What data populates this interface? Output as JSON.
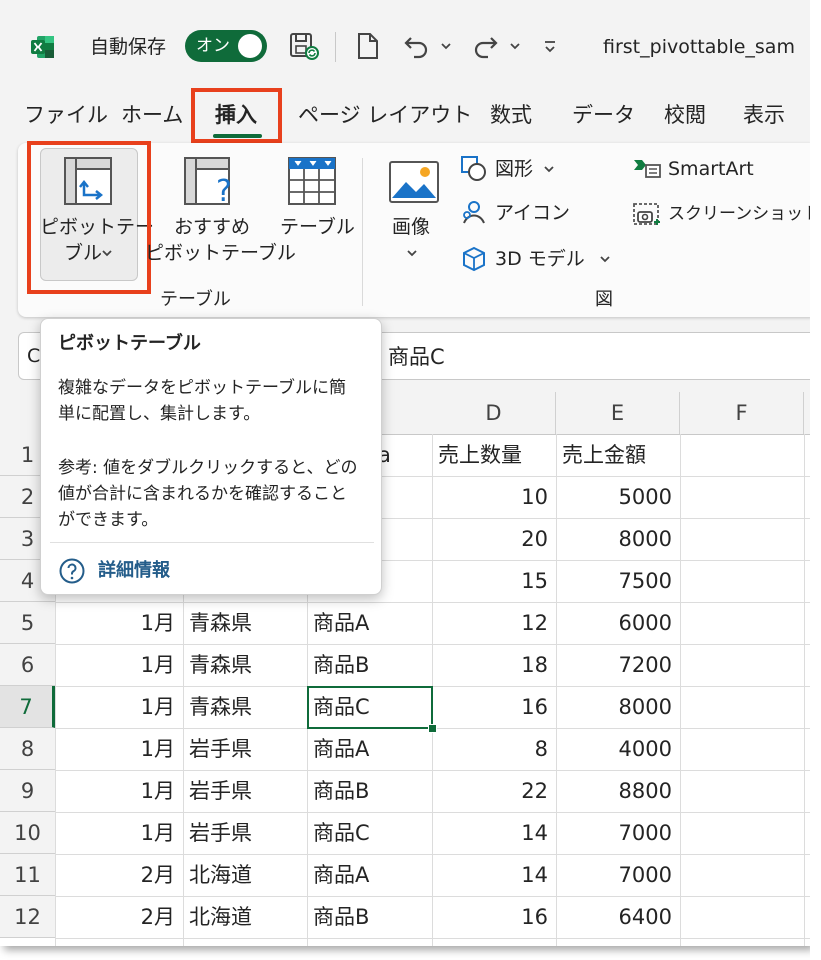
{
  "titlebar": {
    "autosave_label": "自動保存",
    "autosave_state": "オン",
    "filename": "first_pivottable_sam"
  },
  "tabs": [
    {
      "label": "ファイル",
      "active": false
    },
    {
      "label": "ホーム",
      "active": false
    },
    {
      "label": "挿入",
      "active": true
    },
    {
      "label": "ページ レイアウト",
      "active": false
    },
    {
      "label": "数式",
      "active": false
    },
    {
      "label": "データ",
      "active": false
    },
    {
      "label": "校閲",
      "active": false
    },
    {
      "label": "表示",
      "active": false
    }
  ],
  "ribbon": {
    "pivot_line1": "ピボットテー",
    "pivot_line2": "ブル",
    "recommended_line1": "おすすめ",
    "recommended_line2": "ピボットテーブル",
    "table": "テーブル",
    "group_table": "テーブル",
    "image": "画像",
    "shapes": "図形",
    "icons": "アイコン",
    "model3d": "3D モデル",
    "smartart": "SmartArt",
    "screenshot": "スクリーンショット",
    "group_illustration": "図"
  },
  "formula": {
    "namebox": "C",
    "value": "商品C"
  },
  "tooltip": {
    "title": "ピボットテーブル",
    "desc_line1": "複雑なデータをピボットテーブルに簡",
    "desc_line2": "単に配置し、集計します。",
    "tip_line1": "参考: 値をダブルクリックすると、どの",
    "tip_line2": "値が合計に含まれるかを確認すること",
    "tip_line3": "ができます。",
    "link": "詳細情報"
  },
  "grid": {
    "visible_columns": [
      "D",
      "E",
      "F"
    ],
    "header_row": {
      "d": "売上数量",
      "e": "売上金額",
      "c_partial": "a"
    },
    "rows": [
      {
        "n": "1"
      },
      {
        "n": "2",
        "d": "10",
        "e": "5000"
      },
      {
        "n": "3",
        "d": "20",
        "e": "8000"
      },
      {
        "n": "4",
        "d": "15",
        "e": "7500"
      },
      {
        "n": "5",
        "a": "1月",
        "b": "青森県",
        "c": "商品A",
        "d": "12",
        "e": "6000"
      },
      {
        "n": "6",
        "a": "1月",
        "b": "青森県",
        "c": "商品B",
        "d": "18",
        "e": "7200"
      },
      {
        "n": "7",
        "a": "1月",
        "b": "青森県",
        "c": "商品C",
        "d": "16",
        "e": "8000"
      },
      {
        "n": "8",
        "a": "1月",
        "b": "岩手県",
        "c": "商品A",
        "d": "8",
        "e": "4000"
      },
      {
        "n": "9",
        "a": "1月",
        "b": "岩手県",
        "c": "商品B",
        "d": "22",
        "e": "8800"
      },
      {
        "n": "10",
        "a": "1月",
        "b": "岩手県",
        "c": "商品C",
        "d": "14",
        "e": "7000"
      },
      {
        "n": "11",
        "a": "2月",
        "b": "北海道",
        "c": "商品A",
        "d": "14",
        "e": "7000"
      },
      {
        "n": "12",
        "a": "2月",
        "b": "北海道",
        "c": "商品B",
        "d": "16",
        "e": "6400"
      }
    ]
  },
  "colors": {
    "excel_green": "#0f6b3a",
    "highlight_red": "#e8401c",
    "link_blue": "#245d8a"
  }
}
